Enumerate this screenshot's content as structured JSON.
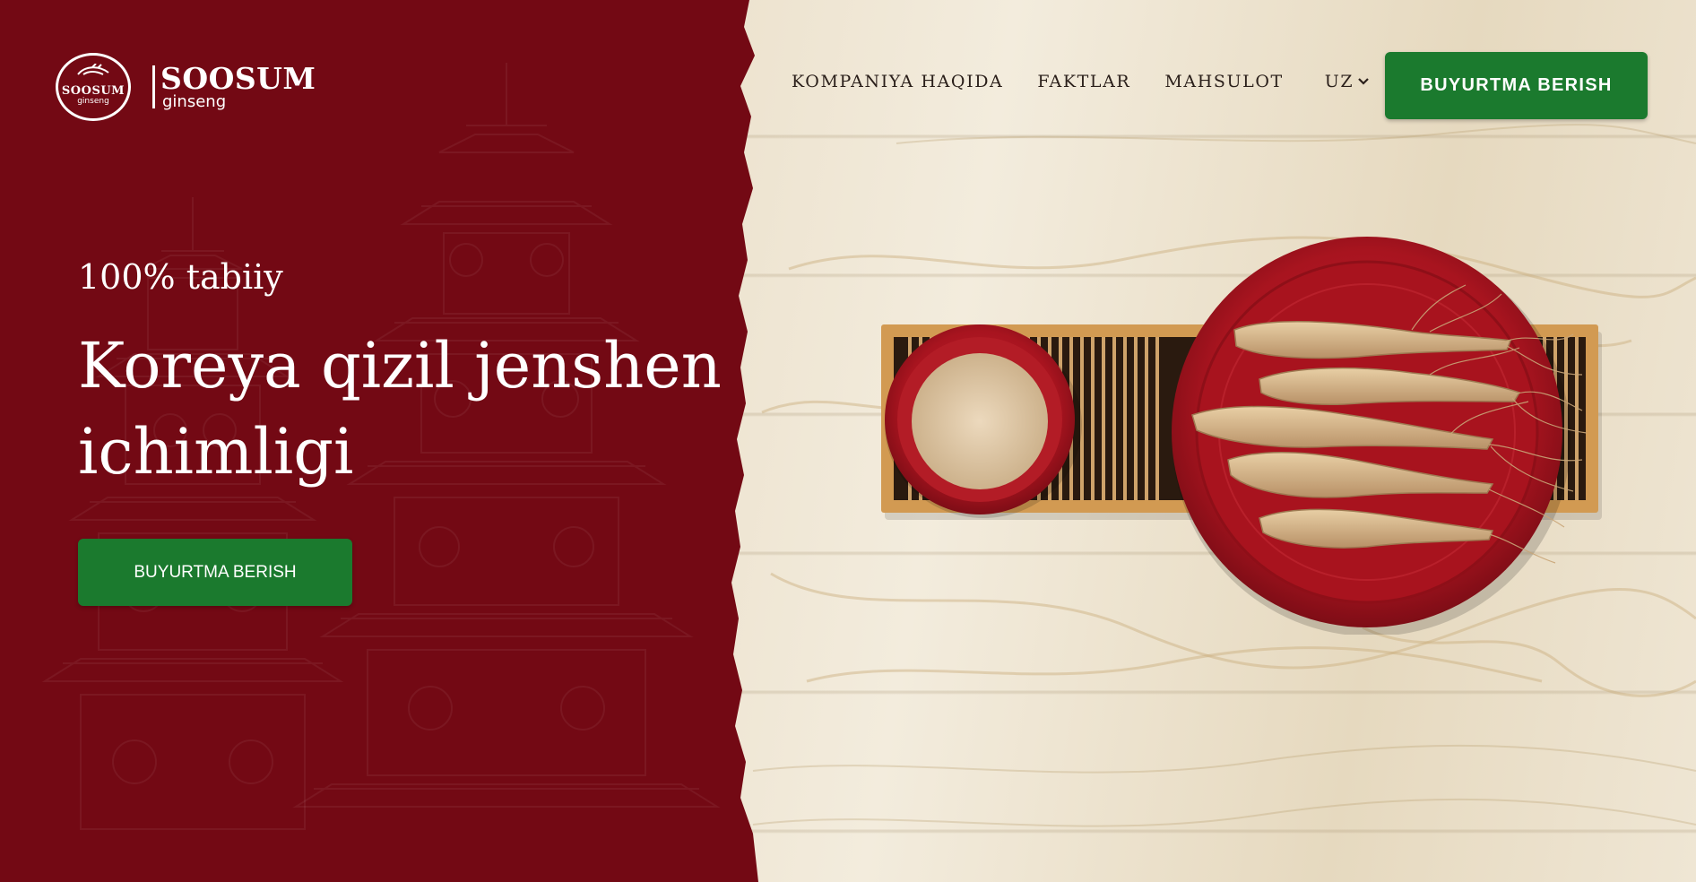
{
  "brand": {
    "badge_line1": "SOOSUM",
    "badge_line2": "ginseng",
    "name": "SOOSUM",
    "tagline": "ginseng",
    "logo_icon": "ginseng-root-icon"
  },
  "nav": {
    "items": [
      "KOMPANIYA HAQIDA",
      "FAKTLAR",
      "MAHSULOT"
    ],
    "language": "UZ",
    "language_icon": "chevron-down-icon",
    "cta_label": "BUYURTMA BERISH"
  },
  "hero": {
    "kicker": "100% tabiiy",
    "headline": "Koreya qizil jenshen ichimligi",
    "cta_label": "BUYURTMA BERISH"
  },
  "colors": {
    "brand_red": "#730914",
    "cta_green": "#1b7a2e",
    "wood_light": "#efe6d4"
  }
}
